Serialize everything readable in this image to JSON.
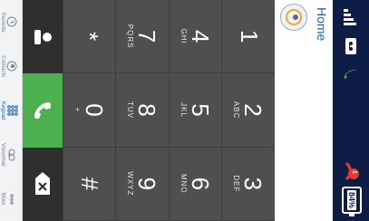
{
  "status_bar": {
    "notification_count": "1",
    "battery_percent": "84%"
  },
  "header": {
    "tab_label": "Home"
  },
  "keypad": [
    {
      "digit": "1",
      "letters": ""
    },
    {
      "digit": "2",
      "letters": "ABC"
    },
    {
      "digit": "3",
      "letters": "DEF"
    },
    {
      "digit": "4",
      "letters": "GHI"
    },
    {
      "digit": "5",
      "letters": "JKL"
    },
    {
      "digit": "6",
      "letters": "MNO"
    },
    {
      "digit": "7",
      "letters": "PQRS"
    },
    {
      "digit": "8",
      "letters": "TUV"
    },
    {
      "digit": "9",
      "letters": "WXYZ"
    },
    {
      "digit": "*",
      "letters": ""
    },
    {
      "digit": "0",
      "letters": "+"
    },
    {
      "digit": "#",
      "letters": ""
    }
  ],
  "bottom_nav": [
    {
      "label": "Recents",
      "icon": "clock-icon"
    },
    {
      "label": "Contacts",
      "icon": "contacts-icon"
    },
    {
      "label": "Keypad",
      "icon": "dialpad-icon"
    },
    {
      "label": "Voicemail",
      "icon": "voicemail-icon"
    },
    {
      "label": "More",
      "icon": "more-icon"
    }
  ],
  "colors": {
    "status_bar": "#0d1d45",
    "accent": "#1f63b3",
    "call_green": "#4caf50",
    "keypad_bg": "#4f4f4f",
    "notification_red": "#e53935"
  }
}
